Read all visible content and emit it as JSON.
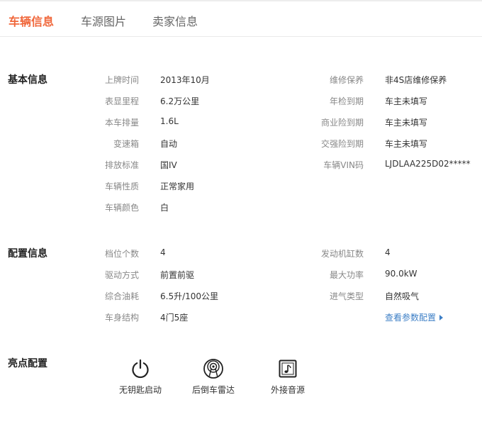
{
  "tabs": [
    {
      "label": "车辆信息",
      "active": true
    },
    {
      "label": "车源图片",
      "active": false
    },
    {
      "label": "卖家信息",
      "active": false
    }
  ],
  "basic": {
    "title": "基本信息",
    "left": [
      {
        "label": "上牌时间",
        "value": "2013年10月"
      },
      {
        "label": "表显里程",
        "value": "6.2万公里"
      },
      {
        "label": "本车排量",
        "value": "1.6L"
      },
      {
        "label": "变速箱",
        "value": "自动"
      },
      {
        "label": "排放标准",
        "value": "国IV"
      },
      {
        "label": "车辆性质",
        "value": "正常家用"
      },
      {
        "label": "车辆颜色",
        "value": "白"
      }
    ],
    "right": [
      {
        "label": "维修保养",
        "value": "非4S店维修保养"
      },
      {
        "label": "年检到期",
        "value": "车主未填写"
      },
      {
        "label": "商业险到期",
        "value": "车主未填写"
      },
      {
        "label": "交强险到期",
        "value": "车主未填写"
      },
      {
        "label": "车辆VIN码",
        "value": "LJDLAA225D02*****"
      }
    ]
  },
  "config": {
    "title": "配置信息",
    "left": [
      {
        "label": "档位个数",
        "value": "4"
      },
      {
        "label": "驱动方式",
        "value": "前置前驱"
      },
      {
        "label": "综合油耗",
        "value": "6.5升/100公里"
      },
      {
        "label": "车身结构",
        "value": "4门5座"
      }
    ],
    "right": [
      {
        "label": "发动机缸数",
        "value": "4"
      },
      {
        "label": "最大功率",
        "value": "90.0kW"
      },
      {
        "label": "进气类型",
        "value": "自然吸气"
      }
    ],
    "link": "查看参数配置"
  },
  "highlights": {
    "title": "亮点配置",
    "items": [
      {
        "label": "无钥匙启动",
        "icon": "power-icon"
      },
      {
        "label": "后倒车雷达",
        "icon": "radar-icon"
      },
      {
        "label": "外接音源",
        "icon": "music-note-icon"
      }
    ]
  },
  "colors": {
    "accent": "#f0683c",
    "link": "#3d7fc6",
    "label": "#888888",
    "text": "#333333"
  }
}
